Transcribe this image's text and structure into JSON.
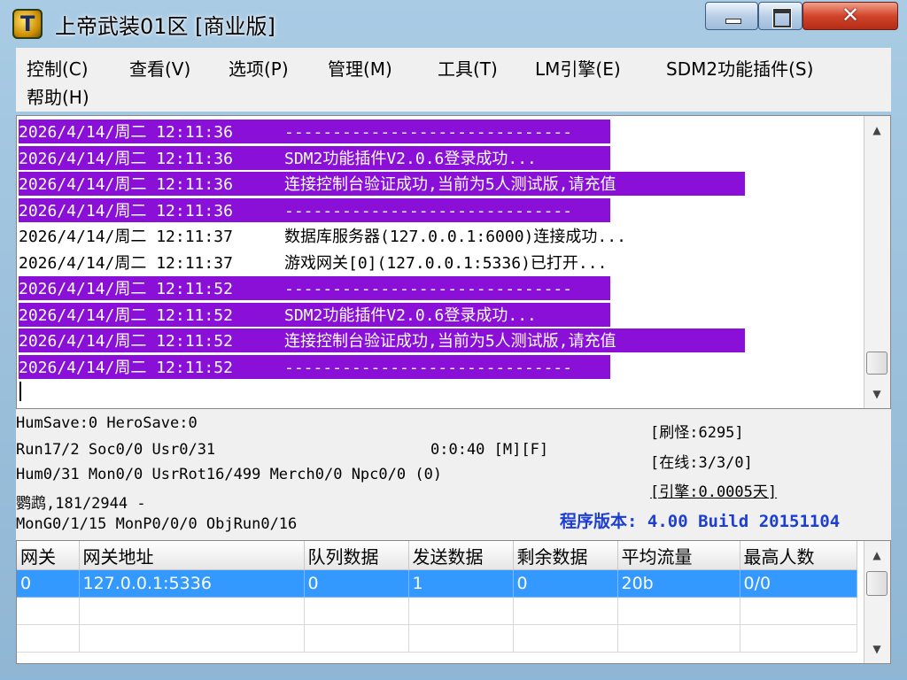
{
  "window": {
    "title": "上帝武装01区 [商业版]",
    "close_glyph": "✕",
    "app_icon": "app-icon"
  },
  "menu": [
    "控制(C)",
    "查看(V)",
    "选项(P)",
    "管理(M)",
    "工具(T)",
    "LM引擎(E)",
    "SDM2功能插件(S)",
    "帮助(H)"
  ],
  "log": [
    {
      "ts": "2026/4/14/周二 12:11:36",
      "msg": "------------------------------",
      "highlight": true
    },
    {
      "ts": "2026/4/14/周二 12:11:36",
      "msg": "SDM2功能插件V2.0.6登录成功...",
      "highlight": true
    },
    {
      "ts": "2026/4/14/周二 12:11:36",
      "msg": "连接控制台验证成功,当前为5人测试版,请充值",
      "highlight": true
    },
    {
      "ts": "2026/4/14/周二 12:11:36",
      "msg": "------------------------------",
      "highlight": true
    },
    {
      "ts": "2026/4/14/周二 12:11:37",
      "msg": "数据库服务器(127.0.0.1:6000)连接成功...",
      "highlight": false
    },
    {
      "ts": "2026/4/14/周二 12:11:37",
      "msg": "游戏网关[0](127.0.0.1:5336)已打开...",
      "highlight": false
    },
    {
      "ts": "2026/4/14/周二 12:11:52",
      "msg": "------------------------------",
      "highlight": true
    },
    {
      "ts": "2026/4/14/周二 12:11:52",
      "msg": "SDM2功能插件V2.0.6登录成功...",
      "highlight": true
    },
    {
      "ts": "2026/4/14/周二 12:11:52",
      "msg": "连接控制台验证成功,当前为5人测试版,请充值",
      "highlight": true
    },
    {
      "ts": "2026/4/14/周二 12:11:52",
      "msg": "------------------------------",
      "highlight": true
    }
  ],
  "status": {
    "line1": "HumSave:0 HeroSave:0",
    "line2": "Run17/2 Soc0/0 Usr0/31",
    "timer": "0:0:40 [M][F]",
    "line3": "Hum0/31 Mon0/0 UsrRot16/499 Merch0/0 Npc0/0 (0)",
    "line4": "鹦鹉,181/2944 -",
    "line5": "MonG0/1/15 MonP0/0/0 ObjRun0/16",
    "refresh": "[刷怪:6295]",
    "online": "[在线:3/3/0]",
    "engine": "[引擎:0.0005天]",
    "version": "程序版本: 4.00 Build 20151104"
  },
  "grid": {
    "columns": [
      "网关",
      "网关地址",
      "队列数据",
      "发送数据",
      "剩余数据",
      "平均流量",
      "最高人数"
    ],
    "rows": [
      [
        "0",
        "127.0.0.1:5336",
        "0",
        "1",
        "0",
        "20b",
        "0/0"
      ]
    ]
  },
  "colors": {
    "highlight_bg": "#8a10d8",
    "selected_row": "#3399ff",
    "version_text": "#1c3ed2"
  }
}
